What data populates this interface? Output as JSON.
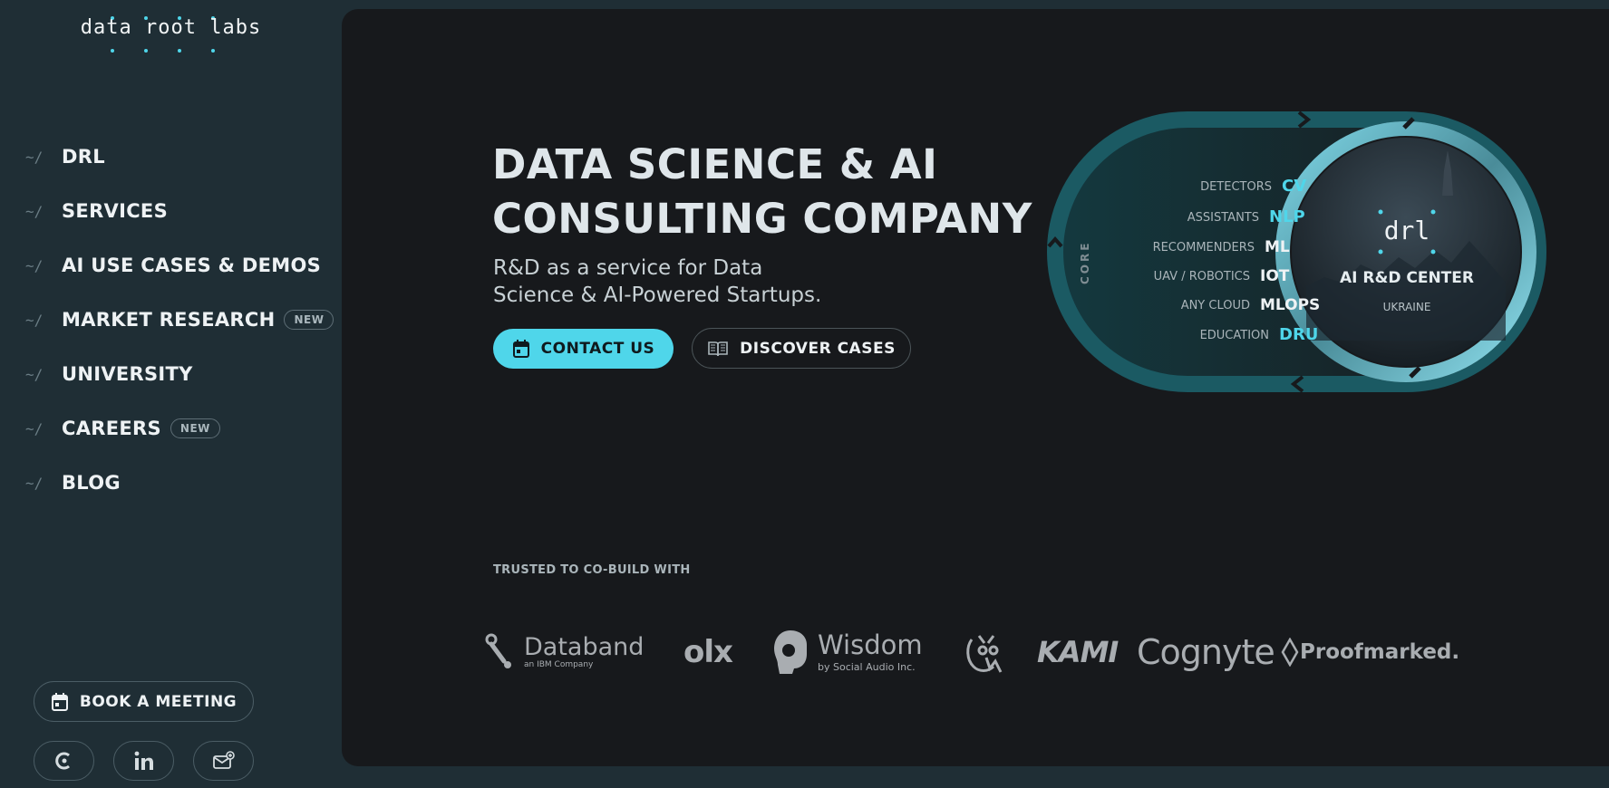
{
  "brand": {
    "logo_text": "data root labs"
  },
  "nav": {
    "prefix": "~/",
    "items": [
      {
        "label": "DRL",
        "badge": ""
      },
      {
        "label": "SERVICES",
        "badge": ""
      },
      {
        "label": "AI USE CASES & DEMOS",
        "badge": ""
      },
      {
        "label": "MARKET RESEARCH",
        "badge": "NEW"
      },
      {
        "label": "UNIVERSITY",
        "badge": ""
      },
      {
        "label": "CAREERS",
        "badge": "NEW"
      },
      {
        "label": "BLOG",
        "badge": ""
      }
    ]
  },
  "sidebar_actions": {
    "book_label": "BOOK A MEETING",
    "social_icons": [
      "clutch-icon",
      "linkedin-icon",
      "email-icon"
    ]
  },
  "hero": {
    "title_line1": "DATA SCIENCE & AI",
    "title_line2": "CONSULTING COMPANY",
    "subtitle_line1": "R&D as a service for Data",
    "subtitle_line2": "Science & AI-Powered Startups.",
    "contact_label": "CONTACT US",
    "discover_label": "DISCOVER CASES"
  },
  "diagram": {
    "core_label": "CORE",
    "center_logo": "drl",
    "center_title": "AI R&D CENTER",
    "center_subtitle": "UKRAINE",
    "rows": [
      {
        "label": "DETECTORS",
        "tag": "CV",
        "accent": true
      },
      {
        "label": "ASSISTANTS",
        "tag": "NLP",
        "accent": true
      },
      {
        "label": "RECOMMENDERS",
        "tag": "ML",
        "accent": false
      },
      {
        "label": "UAV / ROBOTICS",
        "tag": "IOT",
        "accent": false
      },
      {
        "label": "ANY CLOUD",
        "tag": "MLOPS",
        "accent": false
      },
      {
        "label": "EDUCATION",
        "tag": "DRU",
        "accent": true
      }
    ]
  },
  "trusted": {
    "heading": "TRUSTED TO CO-BUILD WITH",
    "logos": [
      {
        "name": "Databand",
        "sub": "an IBM Company"
      },
      {
        "name": "olx",
        "sub": ""
      },
      {
        "name": "Wisdom",
        "sub": "by Social Audio Inc."
      },
      {
        "name": "",
        "sub": ""
      },
      {
        "name": "KAMI",
        "sub": ""
      },
      {
        "name": "Cognyte",
        "sub": ""
      },
      {
        "name": "Proofmarked.",
        "sub": ""
      }
    ]
  },
  "colors": {
    "accent": "#4fd6ea",
    "sidebar_bg": "#1f2e35",
    "main_bg": "#17191c",
    "teal_ring": "#1b5a63"
  }
}
